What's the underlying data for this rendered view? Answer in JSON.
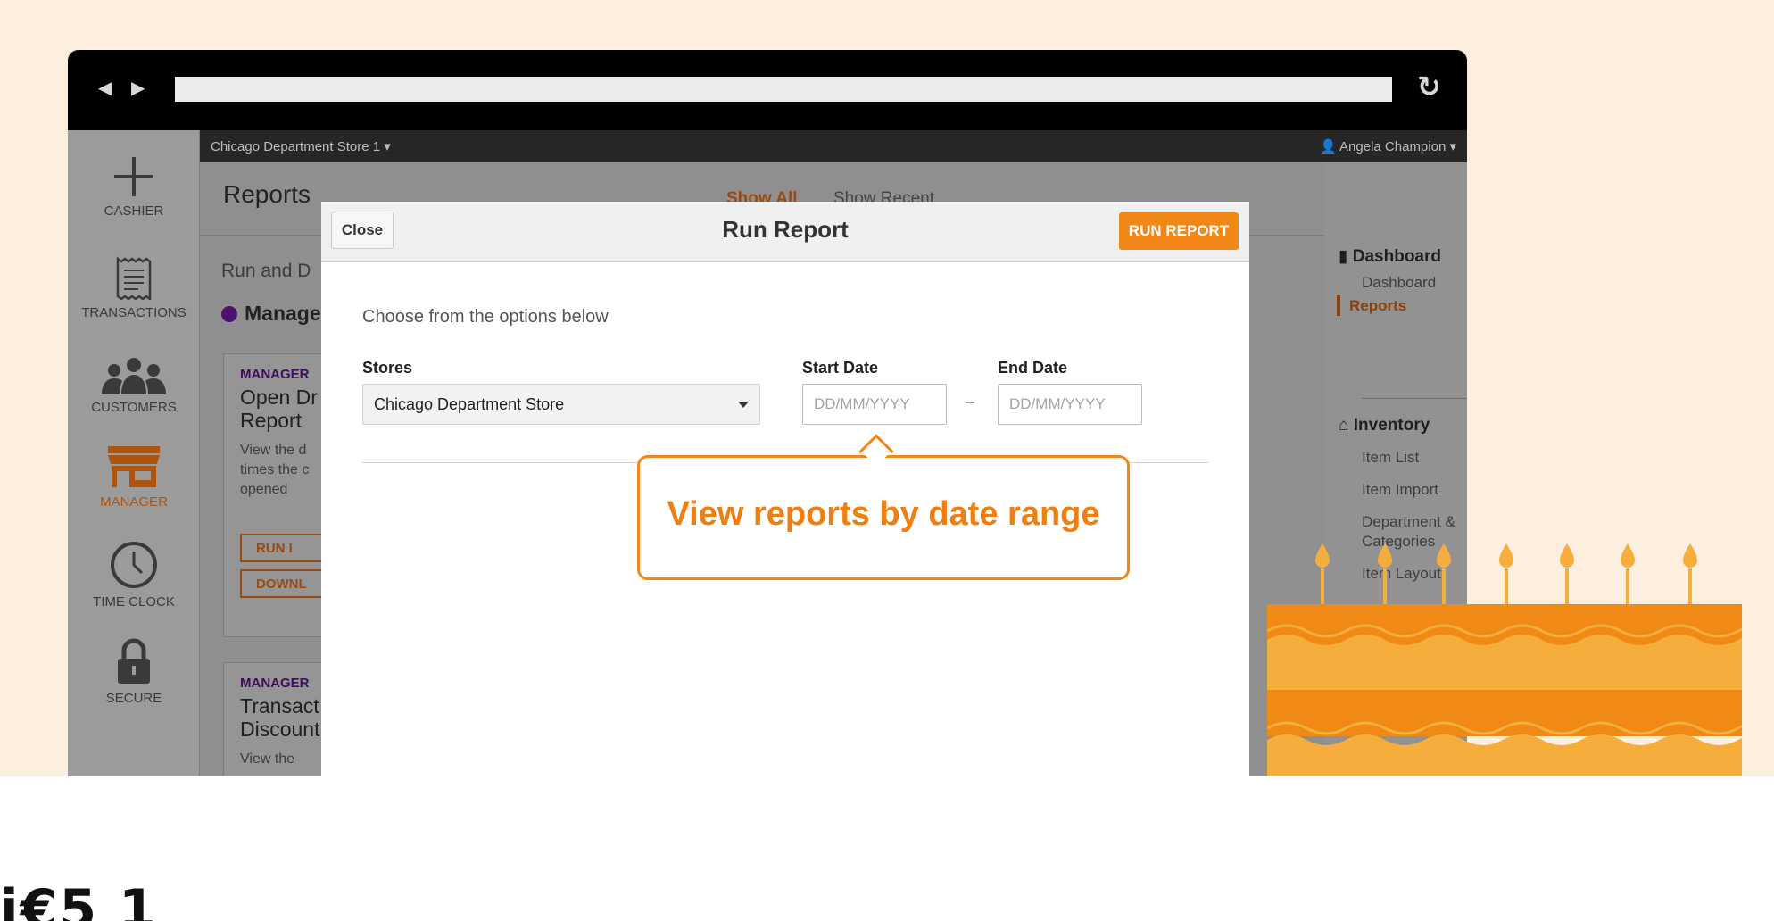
{
  "browser": {
    "nav_arrows": "◀ ▶",
    "reload_icon": "↻"
  },
  "topbar": {
    "store": "Chicago Department Store 1",
    "user": "Angela Champion"
  },
  "leftnav": [
    {
      "label": "CASHIER",
      "icon": "plus-icon"
    },
    {
      "label": "TRANSACTIONS",
      "icon": "receipt-icon"
    },
    {
      "label": "CUSTOMERS",
      "icon": "people-icon"
    },
    {
      "label": "MANAGER",
      "icon": "store-icon",
      "active": true
    },
    {
      "label": "TIME CLOCK",
      "icon": "clock-icon"
    },
    {
      "label": "SECURE",
      "icon": "lock-icon"
    }
  ],
  "page": {
    "title": "Reports",
    "tabs": [
      "Show All",
      "Show Recent"
    ],
    "run_and": "Run and D",
    "section": "Manage",
    "cards": [
      {
        "tag": "MANAGER",
        "title_1": "Open Dr",
        "title_2": "Report",
        "desc_1": "View the d",
        "desc_2": "times the c",
        "desc_3": "opened",
        "btn_run": "RUN I",
        "btn_download": "DOWNL"
      },
      {
        "tag": "MANAGER",
        "title_1": "Transact",
        "title_2": "Discount",
        "desc_1": "View the"
      }
    ]
  },
  "sidenav": {
    "dashboard_heading": "Dashboard",
    "dashboard_link": "Dashboard",
    "reports_link": "Reports",
    "inventory_heading": "Inventory",
    "item_list": "Item List",
    "item_import": "Item Import",
    "departments_1": "Department &",
    "departments_2": "Categories",
    "item_layout": "Item Layout"
  },
  "modal": {
    "close_label": "Close",
    "title": "Run Report",
    "run_label": "RUN REPORT",
    "intro": "Choose from the options below",
    "stores_label": "Stores",
    "stores_value": "Chicago Department Store",
    "start_label": "Start Date",
    "end_label": "End Date",
    "date_placeholder": "DD/MM/YYYY",
    "dash": "–"
  },
  "callout": {
    "text": "View reports by date range"
  },
  "colors": {
    "accent": "#f08716",
    "cake_dark": "#f08a14",
    "cake_light": "#f5ad3c",
    "background": "#fcefdf"
  },
  "stray_text": "i€5 1"
}
